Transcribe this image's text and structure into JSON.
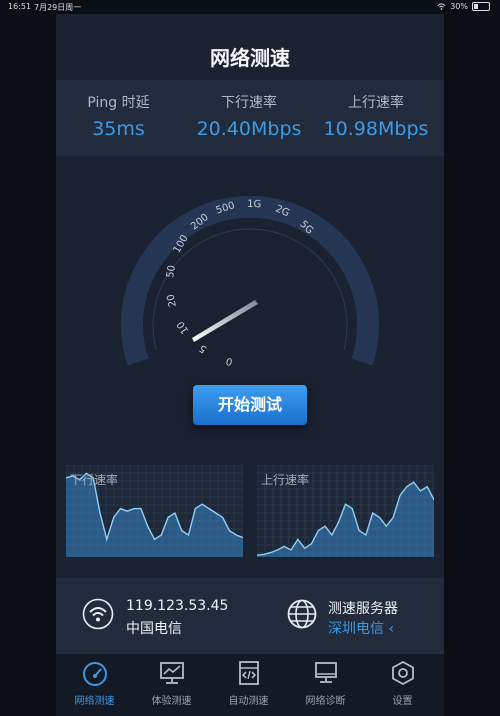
{
  "status_bar": {
    "time": "16:51",
    "date": "7月29日周一",
    "battery": "30%"
  },
  "header": {
    "title": "网络测速"
  },
  "stats": [
    {
      "label": "Ping 时延",
      "value": "35ms"
    },
    {
      "label": "下行速率",
      "value": "20.40Mbps"
    },
    {
      "label": "上行速率",
      "value": "10.98Mbps"
    }
  ],
  "gauge": {
    "ticks": [
      "0",
      "5",
      "10",
      "20",
      "50",
      "100",
      "200",
      "500",
      "1G",
      "2G",
      "5G"
    ],
    "needle_speed_label": "20.40Mbps"
  },
  "start_button": {
    "label": "开始测试"
  },
  "charts": [
    {
      "label": "下行速率",
      "values": [
        0.9,
        0.92,
        0.88,
        0.95,
        0.9,
        0.5,
        0.2,
        0.45,
        0.55,
        0.52,
        0.55,
        0.55,
        0.35,
        0.2,
        0.25,
        0.45,
        0.5,
        0.3,
        0.25,
        0.55,
        0.6,
        0.55,
        0.5,
        0.45,
        0.3,
        0.25,
        0.22
      ]
    },
    {
      "label": "上行速率",
      "values": [
        0.02,
        0.03,
        0.05,
        0.08,
        0.12,
        0.08,
        0.2,
        0.1,
        0.15,
        0.3,
        0.35,
        0.25,
        0.4,
        0.6,
        0.55,
        0.3,
        0.25,
        0.5,
        0.45,
        0.35,
        0.45,
        0.7,
        0.8,
        0.85,
        0.75,
        0.8,
        0.65
      ]
    }
  ],
  "connection": {
    "ip": "119.123.53.45",
    "isp": "中国电信",
    "server_label": "测速服务器",
    "server": "深圳电信 ‹"
  },
  "tabs": [
    {
      "label": "网络测速",
      "icon": "speedometer-icon",
      "active": true
    },
    {
      "label": "体验测速",
      "icon": "monitor-chart-icon",
      "active": false
    },
    {
      "label": "自动测速",
      "icon": "code-file-icon",
      "active": false
    },
    {
      "label": "网络诊断",
      "icon": "computer-icon",
      "active": false
    },
    {
      "label": "设置",
      "icon": "settings-hexagon-icon",
      "active": false
    }
  ],
  "colors": {
    "accent": "#3d9ae6",
    "panel": "#222b3b",
    "background": "#1a2130"
  }
}
